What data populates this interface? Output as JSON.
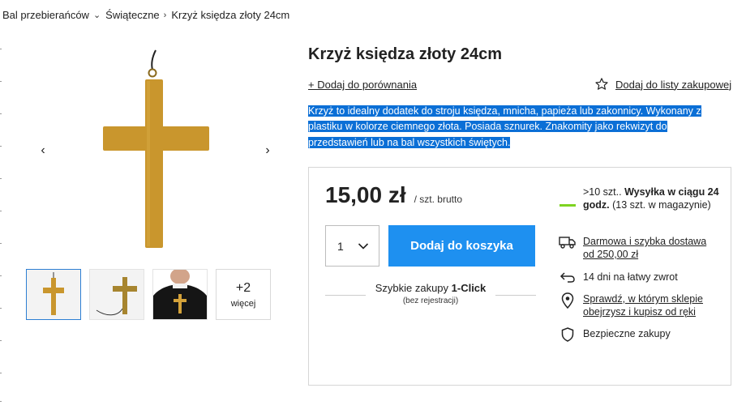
{
  "breadcrumb": {
    "items": [
      "Bal przebierańców",
      "Świąteczne",
      "Krzyż księdza złoty 24cm"
    ]
  },
  "gallery": {
    "more_count": "+2",
    "more_label": "więcej"
  },
  "product": {
    "title": "Krzyż księdza złoty 24cm",
    "compare_label": "+ Dodaj do porównania",
    "wishlist_label": "Dodaj do listy zakupowej",
    "description_lines": [
      "Krzyż to idealny dodatek do stroju księdza, mnicha, papieża lub zakonnicy. Wykonany z",
      "plastiku w kolorze ciemnego złota. Posiada sznurek. Znakomity jako rekwizyt do",
      "przedstawień lub na bal wszystkich świętych."
    ]
  },
  "buybox": {
    "price": "15,00 zł",
    "price_unit": "/ szt. brutto",
    "quantity": "1",
    "add_to_cart": "Dodaj do koszyka",
    "one_click_prefix": "Szybkie zakupy ",
    "one_click_bold": "1-Click",
    "one_click_sub": "(bez rejestracji)"
  },
  "features": {
    "stock_prefix": ">10 szt.. ",
    "stock_bold": "Wysyłka w ciągu 24 godz.",
    "stock_suffix": " (13 szt. w magazynie)",
    "delivery": "Darmowa i szybka dostawa od 250,00 zł",
    "returns": "14 dni na łatwy zwrot",
    "stores": "Sprawdź, w którym sklepie obejrzysz i kupisz od ręki",
    "secure": "Bezpieczne zakupy"
  },
  "colors": {
    "accent": "#1e90f0",
    "selection": "#0b6fd6",
    "cross_gold": "#c9962d",
    "stock_green": "#7ed321"
  },
  "icons": [
    "chevron-right-icon",
    "chevron-left-icon",
    "star-icon",
    "chevron-down-icon",
    "truck-icon",
    "return-arrow-icon",
    "location-pin-icon",
    "shield-icon"
  ]
}
